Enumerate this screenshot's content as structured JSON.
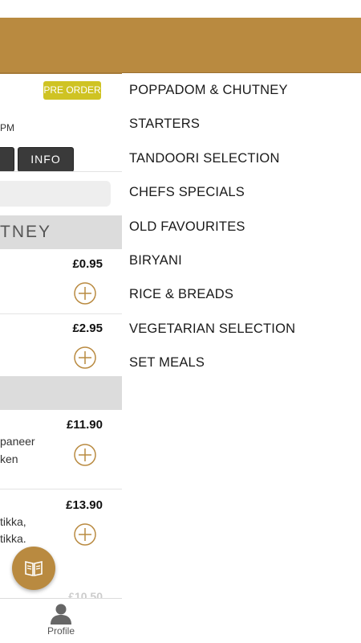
{
  "left_panel": {
    "preorder_label": "PRE ORDER",
    "time_fragment": "PM",
    "info_button_label": "INFO",
    "category_fragment": "TNEY",
    "items": [
      {
        "price": "£0.95"
      },
      {
        "price": "£2.95"
      },
      {
        "price": "£11.90",
        "desc_lines": [
          "paneer",
          "ken"
        ]
      },
      {
        "price": "£13.90",
        "desc_lines": [
          "tikka,",
          " tikka."
        ]
      }
    ],
    "faded_price": "£10.50",
    "bottom_nav": {
      "profile_label": "Profile"
    }
  },
  "drawer": {
    "categories": [
      "POPPADOM & CHUTNEY",
      "STARTERS",
      "TANDOORI SELECTION",
      "CHEFS SPECIALS",
      "OLD FAVOURITES",
      "BIRYANI",
      "RICE & BREADS",
      "VEGETARIAN SELECTION",
      "SET MEALS"
    ]
  },
  "colors": {
    "brand": "#b98a40",
    "preorder": "#cfc323",
    "button_dark": "#3a3a3a"
  },
  "icons": {
    "add": "plus-circle-icon",
    "menu_fab": "book-icon",
    "profile": "person-icon"
  }
}
